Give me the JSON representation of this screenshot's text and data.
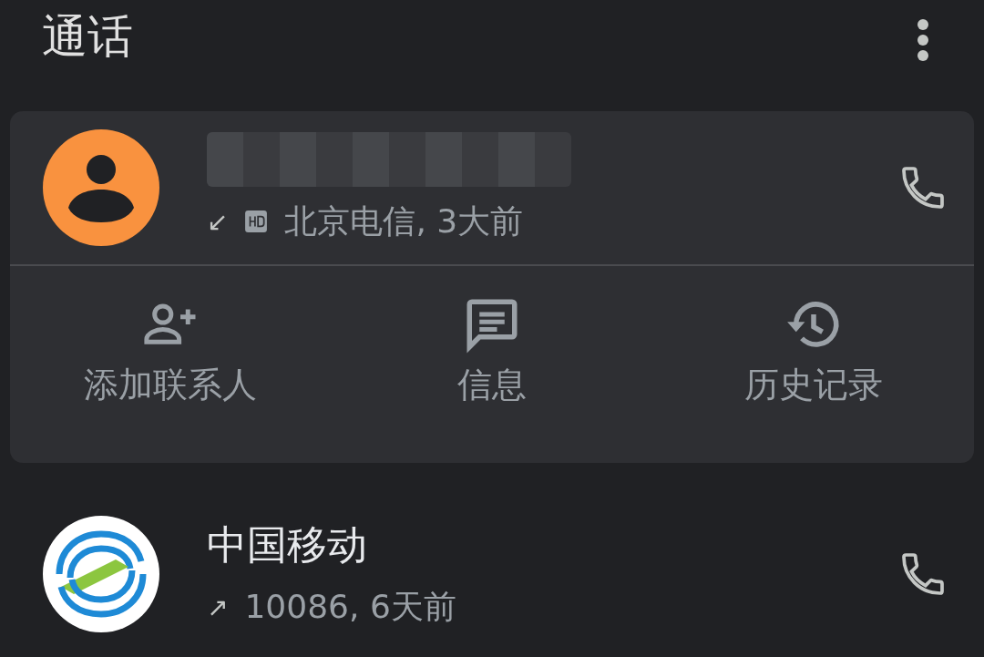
{
  "title": "通话",
  "calls": [
    {
      "kind": "person",
      "direction_icon": "↙",
      "hd": true,
      "detail": "北京电信, 3大前",
      "expanded": true,
      "actions": [
        {
          "kind": "add",
          "label": "添加联系人"
        },
        {
          "kind": "message",
          "label": "信息"
        },
        {
          "kind": "history",
          "label": "历史记录"
        }
      ]
    },
    {
      "kind": "logo",
      "name": "中国移动",
      "direction_icon": "↗",
      "hd": false,
      "detail": "10086, 6天前",
      "expanded": false
    }
  ]
}
